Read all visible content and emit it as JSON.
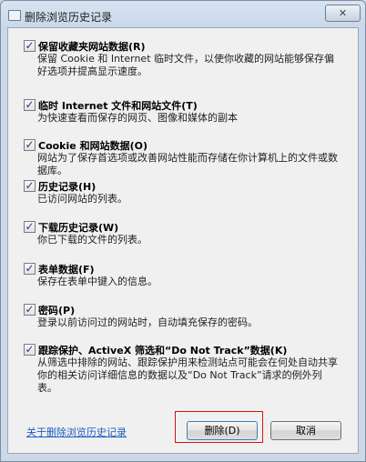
{
  "window": {
    "title": "删除浏览历史记录",
    "close_glyph": "✕"
  },
  "options": [
    {
      "label": "保留收藏夹网站数据(R)",
      "description": "保留 Cookie 和 Internet 临时文件，以使你收藏的网站能够保存偏好选项并提高显示速度。",
      "checked": true
    },
    {
      "label": "临时 Internet 文件和网站文件(T)",
      "description": "为快速查看而保存的网页、图像和媒体的副本",
      "checked": true
    },
    {
      "label": "Cookie 和网站数据(O)",
      "description": "网站为了保存首选项或改善网站性能而存储在你计算机上的文件或数据库。",
      "checked": true
    },
    {
      "label": "历史记录(H)",
      "description": "已访问网站的列表。",
      "checked": true
    },
    {
      "label": "下载历史记录(W)",
      "description": "你已下载的文件的列表。",
      "checked": true
    },
    {
      "label": "表单数据(F)",
      "description": "保存在表单中键入的信息。",
      "checked": true
    },
    {
      "label": "密码(P)",
      "description": "登录以前访问过的网站时，自动填充保存的密码。",
      "checked": true
    },
    {
      "label": "跟踪保护、ActiveX 筛选和“Do Not Track”数据(K)",
      "description": "从筛选中排除的网站、跟踪保护用来检测站点可能会在何处自动共享你的相关访问详细信息的数据以及“Do Not Track”请求的例外列表。",
      "checked": true
    }
  ],
  "check_glyph": "✓",
  "footer": {
    "link_text": "关于删除浏览历史记录",
    "delete_label": "删除(D)",
    "cancel_label": "取消"
  }
}
